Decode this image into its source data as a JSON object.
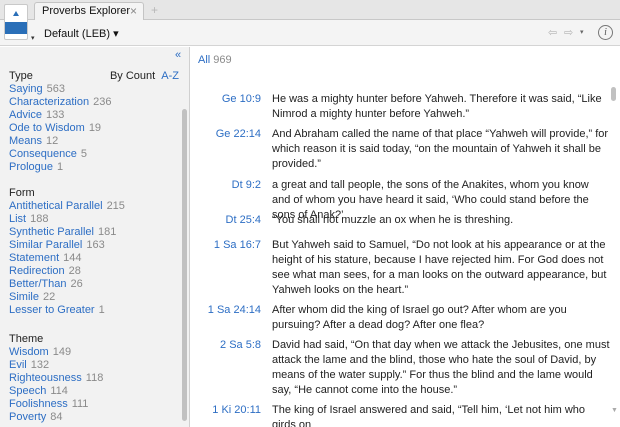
{
  "tab": {
    "title": "Proverbs Explorer",
    "close": "×",
    "new_tab": "+"
  },
  "toolbar": {
    "resource": "Default (LEB) ▾",
    "app_caret": "▾",
    "back": "⇦",
    "forward": "⇨",
    "nav_caret": "▾",
    "info": "i"
  },
  "left_panel": {
    "collapse": "«",
    "sort_by_count": "By Count",
    "sort_az": "A-Z",
    "type": {
      "heading": "Type",
      "items": [
        {
          "label": "Saying",
          "count": "563"
        },
        {
          "label": "Characterization",
          "count": "236"
        },
        {
          "label": "Advice",
          "count": "133"
        },
        {
          "label": "Ode to Wisdom",
          "count": "19"
        },
        {
          "label": "Means",
          "count": "12"
        },
        {
          "label": "Consequence",
          "count": "5"
        },
        {
          "label": "Prologue",
          "count": "1"
        }
      ]
    },
    "form": {
      "heading": "Form",
      "items": [
        {
          "label": "Antithetical Parallel",
          "count": "215"
        },
        {
          "label": "List",
          "count": "188"
        },
        {
          "label": "Synthetic Parallel",
          "count": "181"
        },
        {
          "label": "Similar Parallel",
          "count": "163"
        },
        {
          "label": "Statement",
          "count": "144"
        },
        {
          "label": "Redirection",
          "count": "28"
        },
        {
          "label": "Better/Than",
          "count": "26"
        },
        {
          "label": "Simile",
          "count": "22"
        },
        {
          "label": "Lesser to Greater",
          "count": "1"
        }
      ]
    },
    "theme": {
      "heading": "Theme",
      "items": [
        {
          "label": "Wisdom",
          "count": "149"
        },
        {
          "label": "Evil",
          "count": "132"
        },
        {
          "label": "Righteousness",
          "count": "118"
        },
        {
          "label": "Speech",
          "count": "114"
        },
        {
          "label": "Foolishness",
          "count": "111"
        },
        {
          "label": "Poverty",
          "count": "84"
        }
      ]
    }
  },
  "results": {
    "all_label": "All",
    "all_count": "969",
    "rows": [
      {
        "ref": "Ge 10:9",
        "text": "He was a mighty hunter before Yahweh. Therefore it was said, “Like Nimrod a mighty hunter before Yahweh.”"
      },
      {
        "ref": "Ge 22:14",
        "text": "And Abraham called the name of that place “Yahweh will provide,” for which reason it is said today, “on the mountain of Yahweh it shall be provided.”"
      },
      {
        "ref": "Dt 9:2",
        "text": "a great and tall people, the sons of the Anakites, whom you know and of whom you have heard it said, ‘Who could stand before the sons of Anak?’"
      },
      {
        "ref": "Dt 25:4",
        "text": "“You shall not muzzle an ox when he is threshing."
      },
      {
        "ref": "1 Sa 16:7",
        "text": "But Yahweh said to Samuel, “Do not look at his appearance or at the height of his stature, because I have rejected him. For God does not see what man sees, for a man looks on the outward appearance, but Yahweh looks on the heart.”"
      },
      {
        "ref": "1 Sa 24:14",
        "text": "After whom did the king of Israel go out? After whom are you pursuing? After a dead dog? After one flea?"
      },
      {
        "ref": "2 Sa 5:8",
        "text": "David had said, “On that day when we attack the Jebusites, one must attack the lame and the blind, those who hate the soul of David, by means of the water supply.” For thus the blind and the lame would say, “He cannot come into the house.”"
      },
      {
        "ref": "1 Ki 20:11",
        "text": "The king of Israel answered and said, “Tell him, ‘Let not him who girds on"
      }
    ]
  },
  "colors": {
    "link": "#2d6ec4",
    "count": "#8a8a8a",
    "panel_bg": "#f2f2f2"
  }
}
